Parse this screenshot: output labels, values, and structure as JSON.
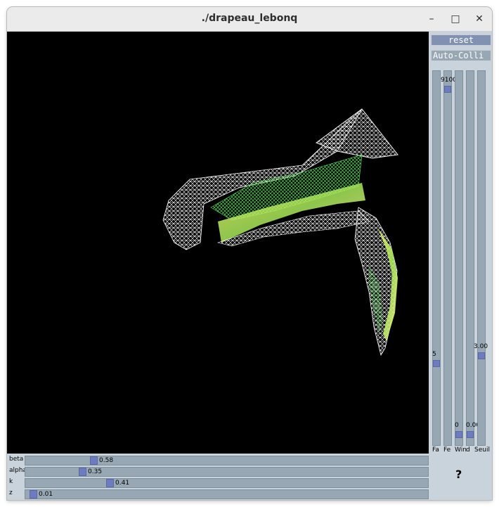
{
  "window": {
    "title": "./drapeau_lebonq",
    "controls": {
      "minimize": "–",
      "maximize": "□",
      "close": "✕"
    }
  },
  "panel": {
    "reset_label": "reset",
    "auto_label": "Auto-Colli",
    "help_label": "?",
    "sliders": [
      {
        "label": "Fa",
        "value": "5",
        "level": 0.79
      },
      {
        "label": "Fe",
        "value": "9100",
        "level": 0.04
      },
      {
        "label": "Win",
        "value": "0",
        "level": 0.985
      },
      {
        "label": "d",
        "value": "0.00",
        "level": 0.985
      },
      {
        "label": "Seuil",
        "value": "3.00",
        "level": 0.77
      }
    ]
  },
  "params": [
    {
      "label": "beta",
      "value": "0.58",
      "level": 0.165
    },
    {
      "label": "alpha",
      "value": "0.35",
      "level": 0.135
    },
    {
      "label": "k",
      "value": "0.41",
      "level": 0.205
    },
    {
      "label": "z",
      "value": "0.01",
      "level": 0.01
    }
  ],
  "colors": {
    "mesh_white": "#ffffff",
    "mesh_yellow": "#f4f48a",
    "mesh_green": "#5de05d",
    "background": "#000000",
    "slider_track": "#97a7b3",
    "slider_thumb": "#6f7bbf"
  }
}
